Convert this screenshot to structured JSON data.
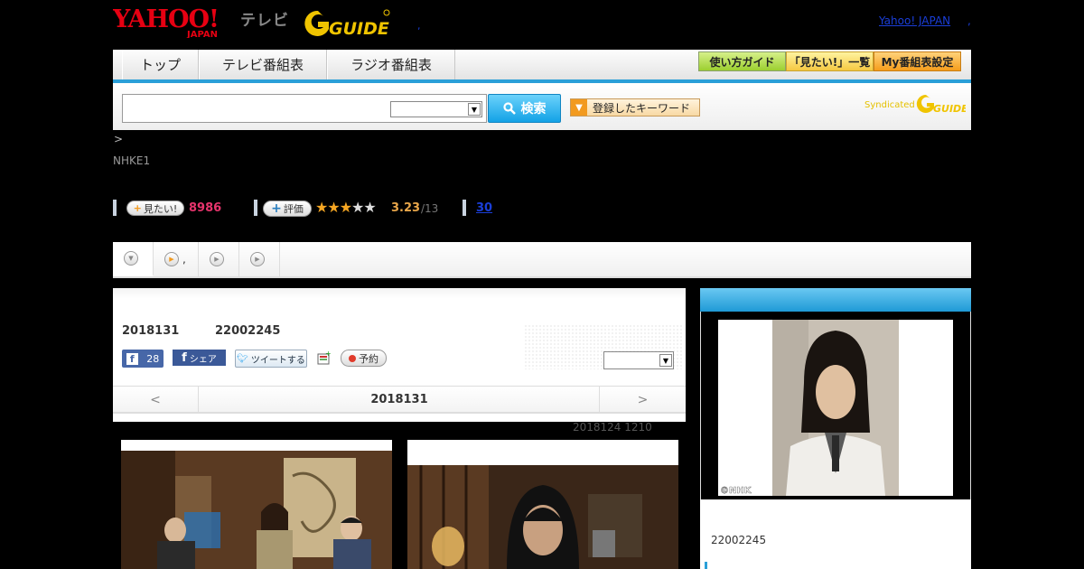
{
  "header": {
    "yahoo_logo": "YAHOO!",
    "yahoo_sub": "JAPAN",
    "tv_label": "テレビ",
    "gguide_logo": "GUIDE",
    "header_dot": ",",
    "yahoo_japan_link": "Yahoo! JAPAN",
    "comma": ","
  },
  "nav": {
    "tabs": [
      "トップ",
      "テレビ番組表",
      "ラジオ番組表"
    ],
    "buttons": [
      "使い方ガイド",
      "「見たい!」一覧",
      "My番組表設定"
    ]
  },
  "search": {
    "input_value": "",
    "select_value": "",
    "button_label": "検索",
    "keyword_button": "登録したキーワード",
    "syndicated_label": "Syndicated",
    "syndicated_logo": "GUIDE"
  },
  "breadcrumb": " >",
  "channel": "NHKE1",
  "stats": {
    "mitai_label": "見たい!",
    "mitai_count": "8986",
    "hyoka_label": "評価",
    "stars_on": 3,
    "stars_total": 5,
    "rating": "3.23",
    "rating_count": "/13",
    "reviews_link": "30"
  },
  "tabs_row": {
    "tab2_label": ","
  },
  "program": {
    "date": "2018131",
    "time": "22002245",
    "like_count": "28",
    "share_label": "シェア",
    "tweet_label": "ツイートする",
    "yoyaku_label": "予約",
    "select_value": ""
  },
  "datenav": {
    "prev": "<",
    "date": "2018131",
    "next": ">"
  },
  "update_text": "2018124  1210",
  "right_panel": {
    "image_credit": "©NHK",
    "time": "22002245"
  },
  "colors": {
    "accent_blue": "#2a9fd8",
    "mitai_pink": "#e6346c",
    "rating_orange": "#e8a64a",
    "link_blue": "#1a3ed8"
  }
}
